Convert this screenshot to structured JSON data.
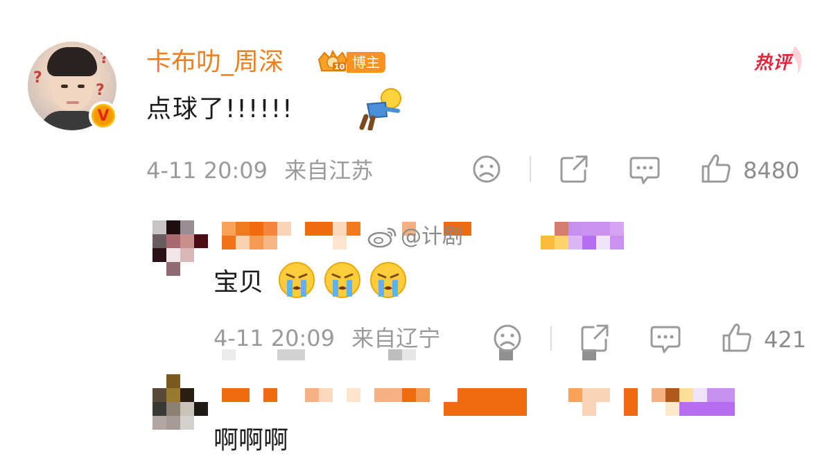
{
  "main_comment": {
    "username": "卡布叻_周深",
    "rank_label": "博主",
    "rank_level": "10",
    "hot_badge": "热评",
    "text": "点球了!!!!!!",
    "timestamp": "4-11 20:09",
    "location": "来自江苏",
    "like_count": "8480"
  },
  "reply_1": {
    "text": "宝贝",
    "timestamp": "4-11 20:09",
    "location": "来自辽宁",
    "like_count": "421"
  },
  "reply_2": {
    "text": "啊啊啊"
  },
  "watermark": "@计剧",
  "icons": [
    "avatar-verified-v-icon",
    "rank-crown-icon",
    "hot-comment-icon",
    "dislike-face-icon",
    "share-icon",
    "reply-icon",
    "like-icon",
    "doll-emoji",
    "crying-emoji",
    "weibo-logo-icon"
  ],
  "colors": {
    "username": "#f07f1e",
    "rank_badge": "#f9931f",
    "hot_badge": "#e6253b",
    "meta_gray": "#9a9a9a"
  }
}
